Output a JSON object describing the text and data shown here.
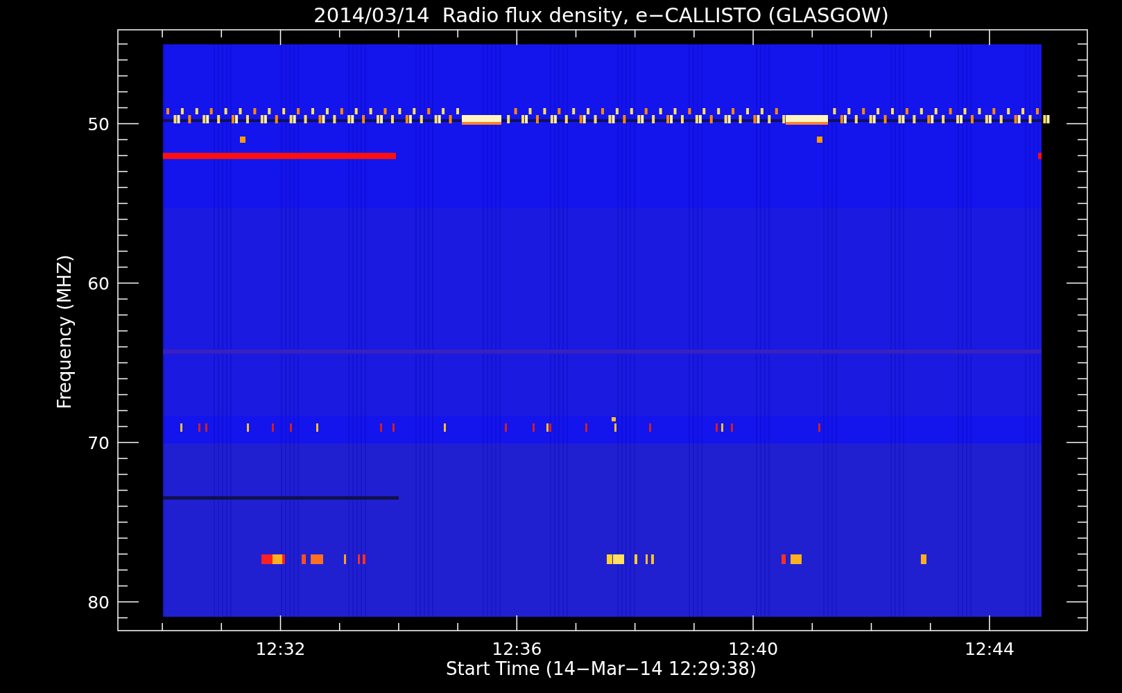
{
  "title": "2014/03/14  Radio flux density, e−CALLISTO (GLASGOW)",
  "ylabel": "Frequency (MHZ)",
  "xlabel": "Start Time (14−Mar−14 12:29:38)",
  "y_tick_labels": [
    "50",
    "60",
    "70",
    "80"
  ],
  "x_tick_labels": [
    "12:32",
    "12:36",
    "12:40",
    "12:44"
  ]
}
